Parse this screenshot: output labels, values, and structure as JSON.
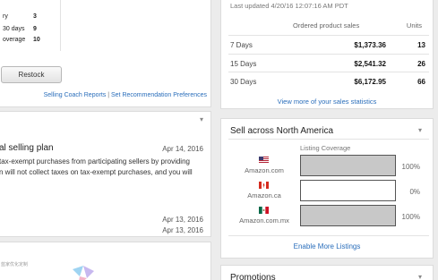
{
  "coach": {
    "rows": [
      {
        "label": "ry",
        "value": "3"
      },
      {
        "label": "30 days",
        "value": "9"
      },
      {
        "label": "overage",
        "value": "10"
      }
    ],
    "restock_label": "Restock",
    "link_reports": "Selling Coach Reports",
    "link_separator": "|",
    "link_preferences": "Set Recommendation Preferences"
  },
  "news": {
    "title": "al selling plan",
    "date1": "Apr 14, 2016",
    "line1": "tax-exempt purchases from participating sellers by providing",
    "line2": "n will not collect taxes on tax-exempt purchases, and you will",
    "date2": "Apr 13, 2016",
    "date3": "Apr 13, 2016"
  },
  "promo_panel": {
    "cjk_text": "蓝家优化定制"
  },
  "sales": {
    "updated": "Last updated 4/20/16 12:07:16 AM PDT",
    "col_sales": "Ordered product sales",
    "col_units": "Units",
    "rows": [
      {
        "period": "7 Days",
        "amount": "$1,373.36",
        "units": "13"
      },
      {
        "period": "15 Days",
        "amount": "$2,541.32",
        "units": "26"
      },
      {
        "period": "30 Days",
        "amount": "$6,172.95",
        "units": "66"
      }
    ],
    "more_link": "View more of your sales statistics"
  },
  "na": {
    "title": "Sell across North America",
    "coverage_label": "Listing Coverage",
    "marketplaces": [
      {
        "name": "Amazon.com",
        "flag": "us-flag-icon",
        "coverage": 100,
        "pct": "100%"
      },
      {
        "name": "Amazon.ca",
        "flag": "ca-flag-icon",
        "coverage": 0,
        "pct": "0%"
      },
      {
        "name": "Amazon.com.mx",
        "flag": "mx-flag-icon",
        "coverage": 100,
        "pct": "100%"
      }
    ],
    "enable_link": "Enable More Listings"
  },
  "promotions": {
    "title": "Promotions"
  },
  "icons": {
    "collapse": "chevron-down-icon"
  },
  "colors": {
    "link": "#2a6ebb",
    "bar_fill": "#c8c8c8",
    "background": "#ececec"
  }
}
